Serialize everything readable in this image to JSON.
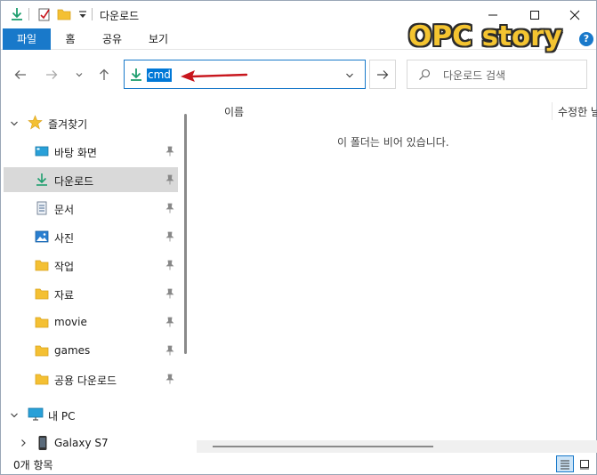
{
  "window": {
    "title": "다운로드"
  },
  "ribbon": {
    "tabs": [
      "파일",
      "홈",
      "공유",
      "보기"
    ]
  },
  "watermark": "OPC story",
  "help_label": "?",
  "address": {
    "value": "cmd"
  },
  "search": {
    "placeholder": "다운로드 검색"
  },
  "sidebar": {
    "quick_access": "즐겨찾기",
    "items": [
      {
        "label": "바탕 화면",
        "icon": "desktop-icon"
      },
      {
        "label": "다운로드",
        "icon": "download-icon"
      },
      {
        "label": "문서",
        "icon": "document-icon"
      },
      {
        "label": "사진",
        "icon": "pictures-icon"
      },
      {
        "label": "작업",
        "icon": "folder-icon"
      },
      {
        "label": "자료",
        "icon": "folder-icon"
      },
      {
        "label": "movie",
        "icon": "folder-icon"
      },
      {
        "label": "games",
        "icon": "folder-icon"
      },
      {
        "label": "공용 다운로드",
        "icon": "folder-icon"
      }
    ],
    "this_pc": "내 PC",
    "device": "Galaxy S7"
  },
  "content": {
    "column_name": "이름",
    "column_modified": "수정한 날",
    "empty_message": "이 폴더는 비어 있습니다."
  },
  "status": {
    "item_count": "0개 항목"
  },
  "colors": {
    "accent": "#1979ca",
    "selection": "#0078d7",
    "watermark": "#f4c430",
    "arrow": "#c8161d"
  }
}
